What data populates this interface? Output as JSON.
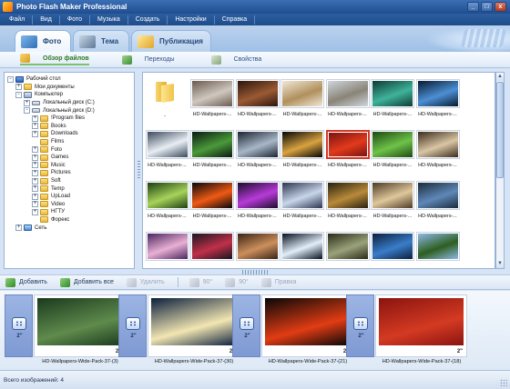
{
  "window": {
    "title": "Photo Flash Maker Professional",
    "buttons": {
      "minimize": "_",
      "maximize": "□",
      "close": "x"
    }
  },
  "menu": [
    "Файл",
    "Вид",
    "Фото",
    "Музыка",
    "Создать",
    "Настройки",
    "Справка"
  ],
  "tabs": [
    {
      "label": "Фото",
      "active": true
    },
    {
      "label": "Тема",
      "active": false
    },
    {
      "label": "Публикация",
      "active": false
    }
  ],
  "subtabs": [
    {
      "label": "Обзор файлов",
      "active": true
    },
    {
      "label": "Переходы",
      "active": false
    },
    {
      "label": "Свойства",
      "active": false
    }
  ],
  "tree": [
    {
      "label": "Рабочий стол",
      "expander": "-",
      "icon": "desktop-icon"
    },
    {
      "label": "Мои документы",
      "expander": "+",
      "icon": "documents-icon"
    },
    {
      "label": "Компьютер",
      "expander": "-",
      "icon": "computer-icon"
    },
    {
      "label": "Локальный диск (C:)",
      "expander": "+",
      "icon": "drive-icon"
    },
    {
      "label": "Локальный диск (D:)",
      "expander": "-",
      "icon": "drive-icon"
    },
    {
      "label": "!Program files",
      "expander": "+",
      "icon": "folder-icon"
    },
    {
      "label": "Books",
      "expander": "+",
      "icon": "folder-icon"
    },
    {
      "label": "Downloads",
      "expander": "+",
      "icon": "folder-icon"
    },
    {
      "label": "Films",
      "expander": "",
      "icon": "folder-icon"
    },
    {
      "label": "Foto",
      "expander": "+",
      "icon": "folder-icon"
    },
    {
      "label": "Games",
      "expander": "+",
      "icon": "folder-icon"
    },
    {
      "label": "Music",
      "expander": "+",
      "icon": "folder-icon"
    },
    {
      "label": "Pictures",
      "expander": "+",
      "icon": "folder-icon"
    },
    {
      "label": "Soft",
      "expander": "+",
      "icon": "folder-icon"
    },
    {
      "label": "Temp",
      "expander": "+",
      "icon": "folder-icon"
    },
    {
      "label": "UpLoad",
      "expander": "+",
      "icon": "folder-icon"
    },
    {
      "label": "Video",
      "expander": "+",
      "icon": "folder-icon"
    },
    {
      "label": "НГТУ",
      "expander": "+",
      "icon": "folder-icon"
    },
    {
      "label": "Форекс",
      "expander": "",
      "icon": "folder-icon"
    },
    {
      "label": "Сеть",
      "expander": "+",
      "icon": "network-icon"
    }
  ],
  "grid": {
    "up_label": "..",
    "thumb_label": "HD-Wallpapers-...",
    "thumbs": [
      {
        "colors": [
          "#6b5a4e",
          "#cfc8c0"
        ]
      },
      {
        "colors": [
          "#2a160e",
          "#9b5a34"
        ]
      },
      {
        "colors": [
          "#f1e7d7",
          "#b0905c"
        ]
      },
      {
        "colors": [
          "#cfd6db",
          "#8a8478"
        ]
      },
      {
        "colors": [
          "#0d3a34",
          "#3fb39a"
        ]
      },
      {
        "colors": [
          "#071a2f",
          "#4d8fd4"
        ]
      },
      {
        "colors": [
          "#3b4a5c",
          "#e9eef4"
        ]
      },
      {
        "colors": [
          "#0a1a12",
          "#4b9a3a"
        ]
      },
      {
        "colors": [
          "#1c2530",
          "#a8b7c8"
        ]
      },
      {
        "colors": [
          "#050505",
          "#d9a340"
        ]
      },
      {
        "colors": [
          "#7a1410",
          "#e23a1c"
        ],
        "selected": true
      },
      {
        "colors": [
          "#1d4a12",
          "#6fc24a"
        ]
      },
      {
        "colors": [
          "#3b2c1c",
          "#d8c6a5"
        ]
      },
      {
        "colors": [
          "#1d3f12",
          "#a7d35a"
        ]
      },
      {
        "colors": [
          "#06070b",
          "#f05a14"
        ]
      },
      {
        "colors": [
          "#1a0d2a",
          "#b83ad9"
        ]
      },
      {
        "colors": [
          "#2c3550",
          "#c8d6ea"
        ]
      },
      {
        "colors": [
          "#28200f",
          "#b98a3a"
        ]
      },
      {
        "colors": [
          "#4c3b25",
          "#e0c79c"
        ]
      },
      {
        "colors": [
          "#1c2a3a",
          "#5e88b8"
        ]
      },
      {
        "colors": [
          "#4a2560",
          "#e9b0d4"
        ]
      },
      {
        "colors": [
          "#1a1520",
          "#c0304a"
        ]
      },
      {
        "colors": [
          "#3a2316",
          "#cc8f5c"
        ]
      },
      {
        "colors": [
          "#05101f",
          "#e2eef9"
        ]
      },
      {
        "colors": [
          "#2a2a18",
          "#9aa27a"
        ]
      },
      {
        "colors": [
          "#0b1f3d",
          "#3a7dc9"
        ]
      },
      {
        "colors": [
          "#8db8e6",
          "#2d5e1f"
        ]
      },
      {
        "colors": [
          "#3a3a3a",
          "#d9d9d9"
        ]
      }
    ]
  },
  "actions": [
    {
      "label": "Добавить",
      "enabled": true,
      "icon": "add-icon"
    },
    {
      "label": "Добавить все",
      "enabled": true,
      "icon": "add-all-icon"
    },
    {
      "label": "Удалить",
      "enabled": false,
      "icon": "delete-icon"
    },
    {
      "label": "90°",
      "enabled": false,
      "icon": "rotate-left-icon"
    },
    {
      "label": "90°",
      "enabled": false,
      "icon": "rotate-right-icon"
    },
    {
      "label": "Правка",
      "enabled": false,
      "icon": "edit-icon"
    }
  ],
  "timeline": {
    "transition_duration": "2\"",
    "slides": [
      {
        "name": "HD-Wallpapers-Wide-Pack-37-(3)",
        "duration": "2\"",
        "colors": [
          "#1b3a1e",
          "#5f8b4c"
        ]
      },
      {
        "name": "HD-Wallpapers-Wide-Pack-37-(30)",
        "duration": "2\"",
        "colors": [
          "#0b1f3d",
          "#f2e6b2"
        ]
      },
      {
        "name": "HD-Wallpapers-Wide-Pack-37-(21)",
        "duration": "2\"",
        "colors": [
          "#070707",
          "#e23c14"
        ]
      },
      {
        "name": "HD-Wallpapers-Wide-Pack-37-(18)",
        "duration": "2\"",
        "colors": [
          "#8a1410",
          "#d43a22"
        ]
      }
    ]
  },
  "status": {
    "text": "Всего изображений: 4"
  }
}
